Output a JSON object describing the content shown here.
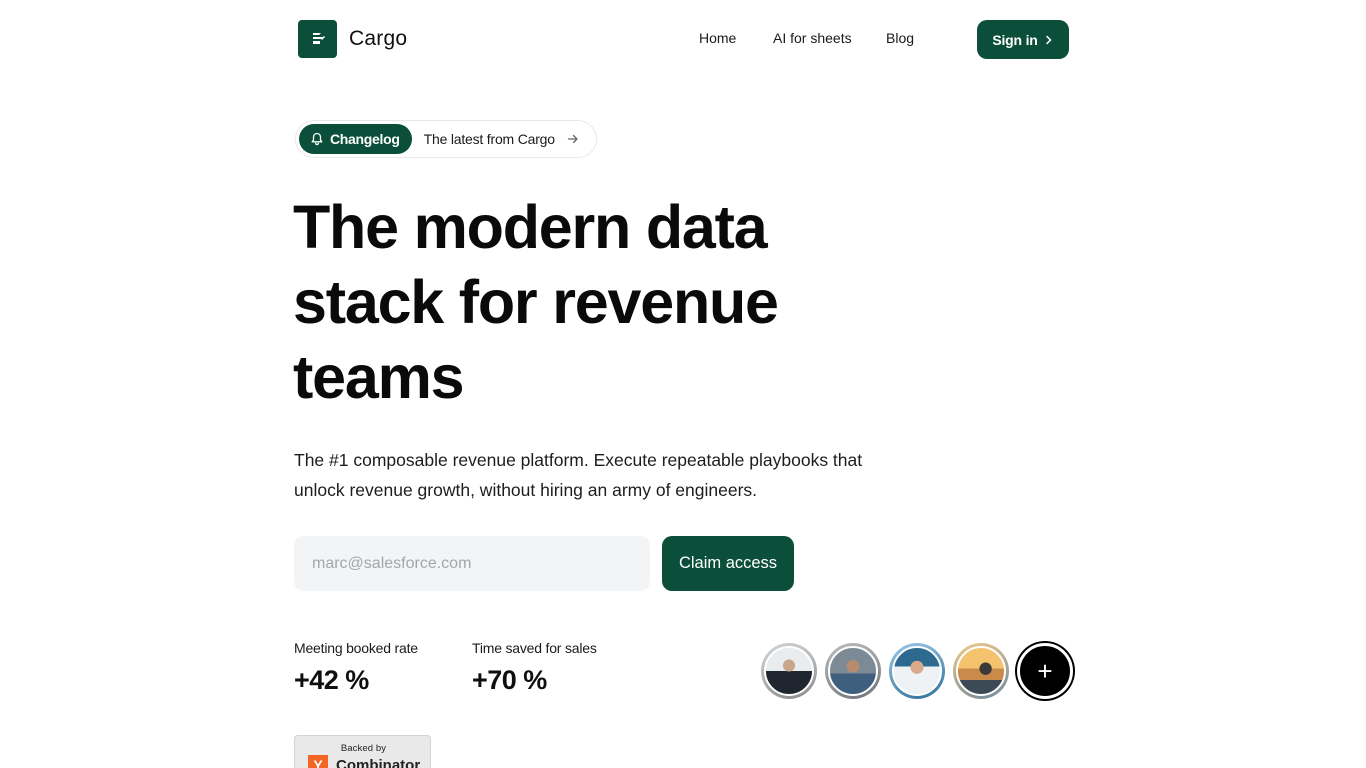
{
  "header": {
    "brand": "Cargo",
    "nav": [
      {
        "label": "Home"
      },
      {
        "label": "AI for sheets"
      },
      {
        "label": "Blog"
      }
    ],
    "signin_label": "Sign in"
  },
  "changelog": {
    "badge": "Changelog",
    "text": "The latest from Cargo"
  },
  "hero": {
    "title_line1": "The modern data",
    "title_line2": "stack for revenue",
    "title_line3": "teams",
    "subtitle": "The #1 composable revenue platform. Execute repeatable playbooks that unlock revenue growth, without hiring an army of engineers."
  },
  "form": {
    "email_placeholder": "marc@salesforce.com",
    "email_value": "",
    "cta_label": "Claim access"
  },
  "stats": [
    {
      "label": "Meeting booked rate",
      "value": "+42 %"
    },
    {
      "label": "Time saved for sales",
      "value": "+70 %"
    }
  ],
  "avatars": {
    "count": 4,
    "add_symbol": "+"
  },
  "backed": {
    "prefix": "Backed by",
    "logo_letter": "Y",
    "name": "Combinator"
  },
  "colors": {
    "brand": "#0b4f3a",
    "yc_orange": "#f26522"
  }
}
